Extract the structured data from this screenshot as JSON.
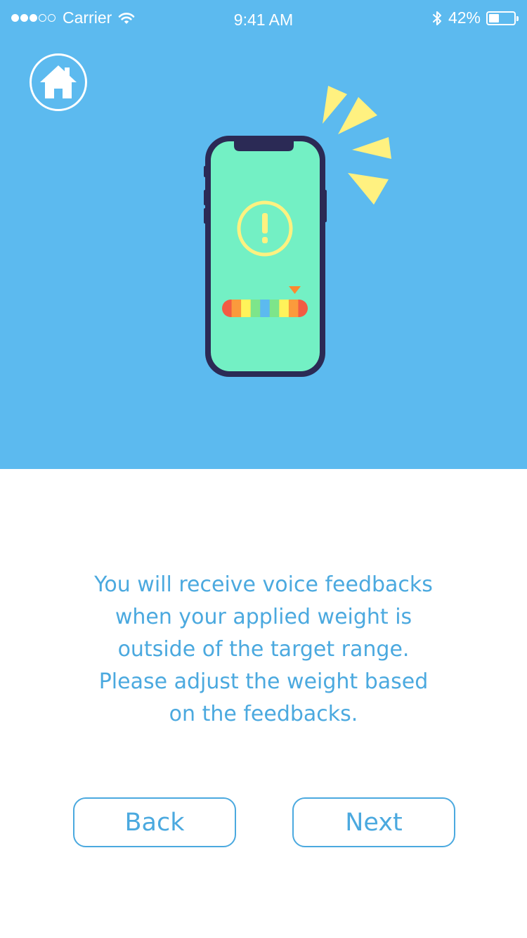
{
  "status_bar": {
    "signal_icon": "signal-dots-icon",
    "signal_bars_filled": 3,
    "signal_bars_total": 5,
    "carrier": "Carrier",
    "wifi_icon": "wifi-icon",
    "time": "9:41 AM",
    "bluetooth_icon": "bluetooth-icon",
    "battery_percent": "42%",
    "battery_level": 0.42
  },
  "header": {
    "home_icon": "home-icon"
  },
  "illustration": {
    "device_icon": "smartphone-icon",
    "alert_icon": "exclamation-circle-icon",
    "vibration_icon": "vibration-rays-icon",
    "scale_marker_icon": "triangle-down-icon",
    "scale_colors": [
      "#f25c43",
      "#fb9a3c",
      "#fff35a",
      "#7de58a",
      "#5cbaef",
      "#7de58a",
      "#fff35a",
      "#fb9a3c",
      "#f25c43"
    ],
    "colors": {
      "background": "#5cbaef",
      "phone_body": "#2b2a55",
      "phone_screen": "#73f0c4",
      "alert": "#fff180",
      "rays": "#fff180",
      "marker": "#fb8a2f"
    }
  },
  "main": {
    "lines": [
      "You will receive voice feedbacks",
      "when your applied weight is",
      "outside of the target range.",
      "Please adjust the weight based",
      "on the feedbacks."
    ]
  },
  "actions": {
    "back_label": "Back",
    "next_label": "Next"
  },
  "theme": {
    "accent": "#4ba9df",
    "hero_background": "#5cbaef"
  }
}
